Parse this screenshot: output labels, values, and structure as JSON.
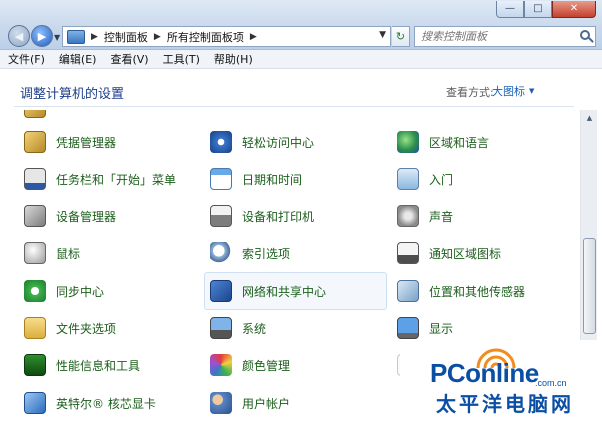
{
  "window": {
    "minimize_glyph": "—",
    "maximize_glyph": "□",
    "close_glyph": "✕"
  },
  "nav": {
    "back_glyph": "◀",
    "forward_glyph": "▶",
    "breadcrumb": [
      "控制面板",
      "所有控制面板项"
    ],
    "refresh_glyph": "↻"
  },
  "search": {
    "placeholder": "搜索控制面板"
  },
  "menu": [
    "文件(F)",
    "编辑(E)",
    "查看(V)",
    "工具(T)",
    "帮助(H)"
  ],
  "header": {
    "title": "调整计算机的设置",
    "view_by_label": "查看方式:",
    "view_by_value": "大图标"
  },
  "items": [
    {
      "label": "凭据管理器",
      "icon": "credential-icon"
    },
    {
      "label": "轻松访问中心",
      "icon": "accessibility-icon"
    },
    {
      "label": "区域和语言",
      "icon": "globe-icon"
    },
    {
      "label": "任务栏和「开始」菜单",
      "icon": "taskbar-icon"
    },
    {
      "label": "日期和时间",
      "icon": "calendar-icon"
    },
    {
      "label": "入门",
      "icon": "getting-started-icon"
    },
    {
      "label": "设备管理器",
      "icon": "device-manager-icon"
    },
    {
      "label": "设备和打印机",
      "icon": "printer-icon"
    },
    {
      "label": "声音",
      "icon": "speaker-icon"
    },
    {
      "label": "鼠标",
      "icon": "mouse-icon"
    },
    {
      "label": "索引选项",
      "icon": "index-icon"
    },
    {
      "label": "通知区域图标",
      "icon": "notification-icon"
    },
    {
      "label": "同步中心",
      "icon": "sync-icon"
    },
    {
      "label": "网络和共享中心",
      "icon": "network-icon"
    },
    {
      "label": "位置和其他传感器",
      "icon": "location-sensor-icon"
    },
    {
      "label": "文件夹选项",
      "icon": "folder-icon"
    },
    {
      "label": "系统",
      "icon": "system-icon"
    },
    {
      "label": "显示",
      "icon": "display-icon"
    },
    {
      "label": "性能信息和工具",
      "icon": "performance-icon"
    },
    {
      "label": "颜色管理",
      "icon": "color-icon"
    },
    {
      "label": "",
      "icon": "blank-icon"
    },
    {
      "label": "英特尔® 核芯显卡",
      "icon": "intel-graphics-icon"
    },
    {
      "label": "用户帐户",
      "icon": "users-icon"
    }
  ],
  "watermark": {
    "logo": "PConline",
    "domain": ".com.cn",
    "chinese": "太平洋电脑网"
  }
}
